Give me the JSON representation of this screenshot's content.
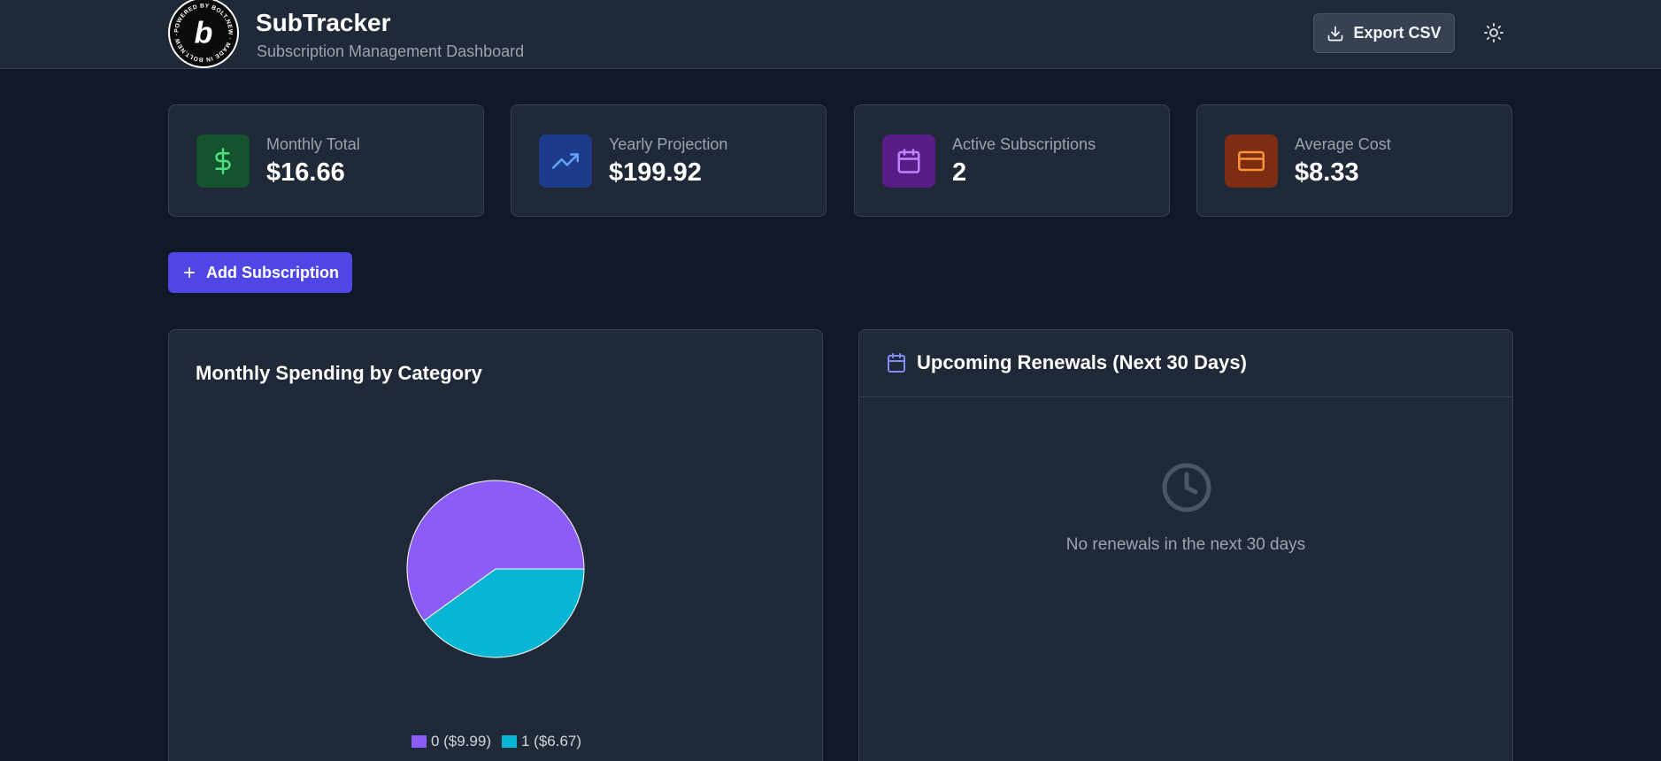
{
  "header": {
    "title": "SubTracker",
    "subtitle": "Subscription Management Dashboard",
    "logo_text": "POWERED BY BOLT.NEW · MADE IN BOLT.NEW ·",
    "export_label": "Export CSV"
  },
  "stats": [
    {
      "label": "Monthly Total",
      "value": "$16.66",
      "icon": "dollar-icon",
      "bg": "#14532d",
      "fg": "#4ade80"
    },
    {
      "label": "Yearly Projection",
      "value": "$199.92",
      "icon": "trending-up-icon",
      "bg": "#1e3a8a",
      "fg": "#60a5fa"
    },
    {
      "label": "Active Subscriptions",
      "value": "2",
      "icon": "calendar-icon",
      "bg": "#581c87",
      "fg": "#c084fc"
    },
    {
      "label": "Average Cost",
      "value": "$8.33",
      "icon": "credit-card-icon",
      "bg": "#7c2d12",
      "fg": "#fb923c"
    }
  ],
  "actions": {
    "add_label": "Add Subscription"
  },
  "chart_panel": {
    "title": "Monthly Spending by Category"
  },
  "chart_data": {
    "type": "pie",
    "title": "Monthly Spending by Category",
    "categories": [
      "0",
      "1"
    ],
    "values": [
      9.99,
      6.67
    ],
    "legend_labels": [
      "0 ($9.99)",
      "1 ($6.67)"
    ],
    "colors": [
      "#8b5cf6",
      "#06b6d4"
    ],
    "legend_position": "bottom"
  },
  "renewals": {
    "title": "Upcoming Renewals (Next 30 Days)",
    "empty_message": "No renewals in the next 30 days"
  },
  "colors": {
    "background": "#111827",
    "surface": "#1f2937",
    "border": "#374151",
    "accent": "#4f46e5"
  }
}
